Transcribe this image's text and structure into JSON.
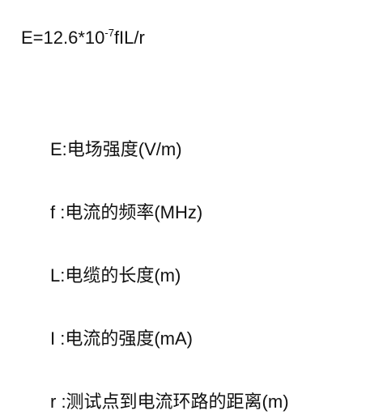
{
  "formula": {
    "main": "E=12.6*10",
    "exponent": "-7",
    "tail": "fIL/r"
  },
  "definitions": [
    {
      "text": "E:电场强度(V/m)"
    },
    {
      "text": "f :电流的频率(MHz)"
    },
    {
      "text": "L:电缆的长度(m)"
    },
    {
      "text": "I :电流的强度(mA)"
    },
    {
      "text": "r :测试点到电流环路的距离(m)"
    }
  ]
}
